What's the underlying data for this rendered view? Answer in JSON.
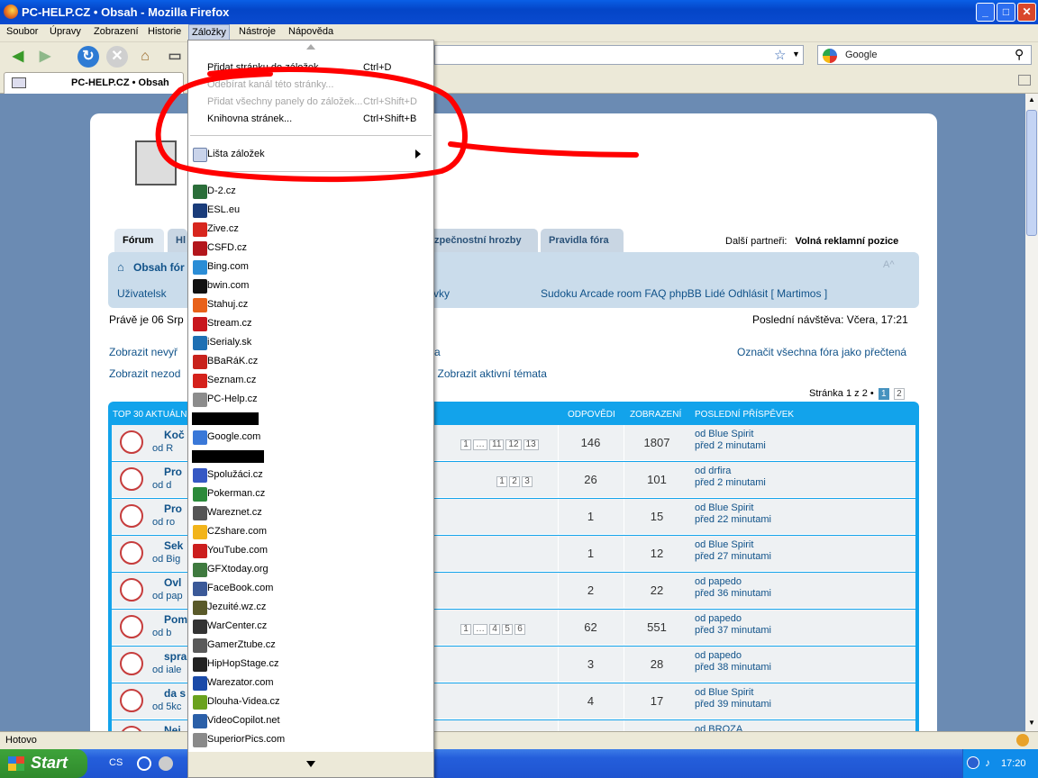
{
  "window": {
    "title": "PC-HELP.CZ • Obsah - Mozilla Firefox",
    "min": "_",
    "max": "□",
    "close": "✕"
  },
  "menubar": [
    "Soubor",
    "Úpravy",
    "Zobrazení",
    "Historie",
    "Záložky",
    "Nástroje",
    "Nápověda"
  ],
  "search": {
    "engine": "Google"
  },
  "tab": {
    "title": "PC-HELP.CZ • Obsah"
  },
  "forum": {
    "tabs": [
      "Fórum",
      "Hl",
      "zpečnostní hrozby",
      "Pravidla fóra"
    ],
    "partners_label": "Další partneři:",
    "partners_value": "Volná reklamní pozice",
    "obsah": "Obsah fór",
    "font_ctrl": "A^",
    "links_left": "Uživatelsk",
    "links_mid": "vky",
    "links_right": "Sudoku   Arcade room   FAQ phpBB   Lidé   Odhlásit [ Martimos ]",
    "now": "Právě je 06 Srp",
    "last_visit": "Poslední návštěva: Včera, 17:21",
    "show_unanswered": "Zobrazit nevyř",
    "show_unanswered2": "a",
    "mark_read": "Označit všechna fóra jako přečtená",
    "show_unread": "Zobrazit nezod",
    "active_topics": "• Zobrazit aktivní témata",
    "pager_text": "Stránka 1 z 2 •",
    "pager": [
      "1",
      "2"
    ],
    "table_title": "TOP 30 AKTUÁLN",
    "col_replies": "ODPOVĚDI",
    "col_views": "ZOBRAZENÍ",
    "col_last": "POSLEDNÍ PŘÍSPĚVEK",
    "rows": [
      {
        "title": "Koč",
        "sub": "od R",
        "replies": "146",
        "views": "1807",
        "by": "od Blue Spirit",
        "when": "před 2 minutami",
        "pages": [
          "1",
          "…",
          "11",
          "12",
          "13"
        ]
      },
      {
        "title": "Pro",
        "sub": "od d",
        "replies": "26",
        "views": "101",
        "by": "od drfira",
        "when": "před 2 minutami",
        "pages": [
          "1",
          "2",
          "3"
        ]
      },
      {
        "title": "Pro",
        "sub": "od ro",
        "replies": "1",
        "views": "15",
        "by": "od Blue Spirit",
        "when": "před 22 minutami",
        "pages": []
      },
      {
        "title": "Sek",
        "sub": "od Big",
        "replies": "1",
        "views": "12",
        "by": "od Blue Spirit",
        "when": "před 27 minutami",
        "pages": []
      },
      {
        "title": "Ovl",
        "sub": "od pap",
        "replies": "2",
        "views": "22",
        "by": "od papedo",
        "when": "před 36 minutami",
        "pages": []
      },
      {
        "title": "Pom",
        "sub": "od b",
        "replies": "62",
        "views": "551",
        "by": "od papedo",
        "when": "před 37 minutami",
        "pages": [
          "1",
          "…",
          "4",
          "5",
          "6"
        ]
      },
      {
        "title": "spra",
        "sub": "od iale",
        "replies": "3",
        "views": "28",
        "by": "od papedo",
        "when": "před 38 minutami",
        "pages": []
      },
      {
        "title": "da s",
        "sub": "od 5kc",
        "replies": "4",
        "views": "17",
        "by": "od Blue Spirit",
        "when": "před 39 minutami",
        "pages": []
      },
      {
        "title": "Nej",
        "sub": "",
        "replies": "",
        "views": "",
        "by": "od BROZA",
        "when": "",
        "pages": []
      }
    ]
  },
  "menu": {
    "add_page": "Přidat stránku do záložek",
    "add_page_sc": "Ctrl+D",
    "subscribe": "Odebírat kanál této stránky...",
    "add_all": "Přidat všechny panely do záložek...",
    "add_all_sc": "Ctrl+Shift+D",
    "library": "Knihovna stránek...",
    "library_sc": "Ctrl+Shift+B",
    "toolbar": "Lišta záložek",
    "bookmarks": [
      {
        "label": "D-2.cz",
        "color": "#2b6e3a"
      },
      {
        "label": "ESL.eu",
        "color": "#1a3c7a"
      },
      {
        "label": "Zive.cz",
        "color": "#d7261e"
      },
      {
        "label": "CSFD.cz",
        "color": "#b3161c"
      },
      {
        "label": "Bing.com",
        "color": "#2b8dd6"
      },
      {
        "label": "bwin.com",
        "color": "#111111"
      },
      {
        "label": "Stahuj.cz",
        "color": "#e8611a"
      },
      {
        "label": "Stream.cz",
        "color": "#c8161d"
      },
      {
        "label": "iSerialy.sk",
        "color": "#1e6fb3"
      },
      {
        "label": "BBaRáK.cz",
        "color": "#c8221c"
      },
      {
        "label": "Seznam.cz",
        "color": "#d4211b"
      },
      {
        "label": "PC-Help.cz",
        "color": "#8c8c8c"
      },
      {
        "label": "",
        "color": "#000000"
      },
      {
        "label": "Google.com",
        "color": "#3a78d8"
      },
      {
        "label": "",
        "color": "#000000"
      },
      {
        "label": "Spolužáci.cz",
        "color": "#3658c4"
      },
      {
        "label": "Pokerman.cz",
        "color": "#2b8a3a"
      },
      {
        "label": "Wareznet.cz",
        "color": "#555555"
      },
      {
        "label": "CZshare.com",
        "color": "#f2b41a"
      },
      {
        "label": "YouTube.com",
        "color": "#cc1e1e"
      },
      {
        "label": "GFXtoday.org",
        "color": "#3f7a3f"
      },
      {
        "label": "FaceBook.com",
        "color": "#3b5998"
      },
      {
        "label": "Jezuité.wz.cz",
        "color": "#5a5a2a"
      },
      {
        "label": "WarCenter.cz",
        "color": "#333333"
      },
      {
        "label": "GamerZtube.cz",
        "color": "#5a5a5a"
      },
      {
        "label": "HipHopStage.cz",
        "color": "#222222"
      },
      {
        "label": "Warezator.com",
        "color": "#1a4aa8"
      },
      {
        "label": "Dlouha-Videa.cz",
        "color": "#6aa21e"
      },
      {
        "label": "VideoCopilot.net",
        "color": "#2a5fa8"
      },
      {
        "label": "SuperiorPics.com",
        "color": "#8a8a8a"
      }
    ]
  },
  "status": {
    "text": "Hotovo"
  },
  "taskbar": {
    "start": "Start",
    "lang": "CS",
    "clock": "17:20"
  },
  "colors": {
    "annotation_red": "#ff0000",
    "xp_blue": "#0a4bd0"
  }
}
